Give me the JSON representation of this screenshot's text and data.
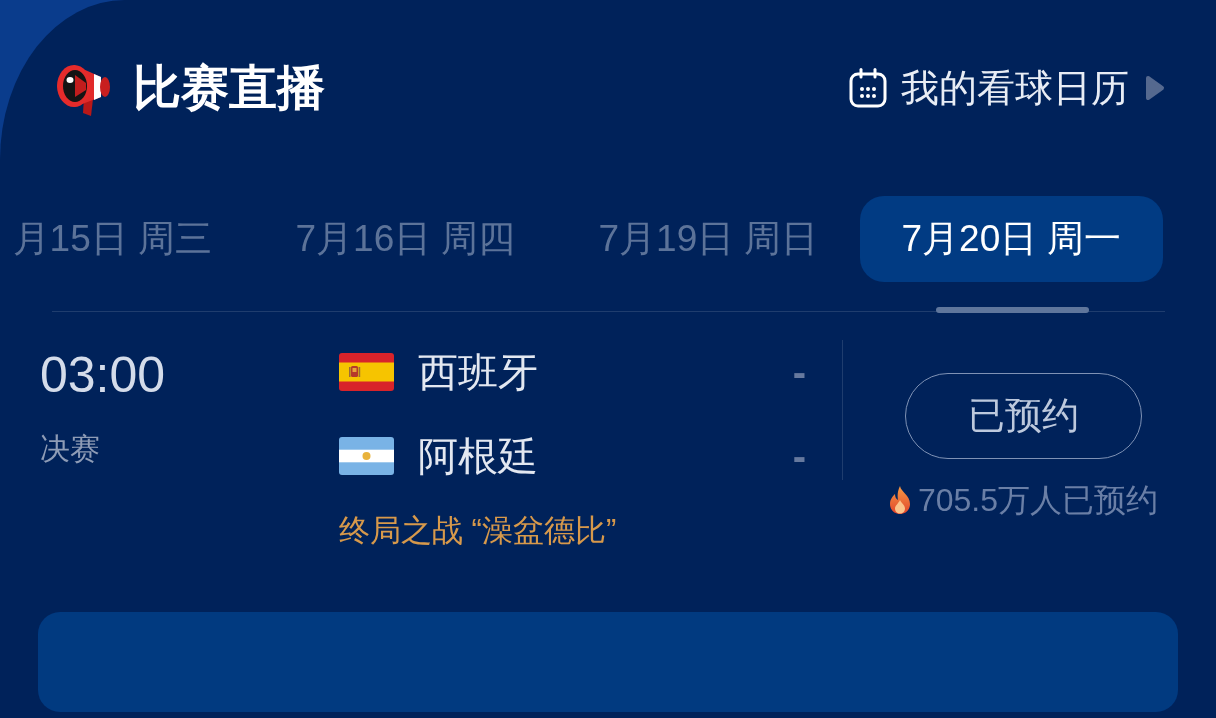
{
  "header": {
    "title": "比赛直播",
    "calendar_link": "我的看球日历"
  },
  "date_tabs": [
    {
      "label": "月15日 周三",
      "selected": false
    },
    {
      "label": "7月16日 周四",
      "selected": false
    },
    {
      "label": "7月19日 周日",
      "selected": false
    },
    {
      "label": "7月20日 周一",
      "selected": true
    }
  ],
  "matches": [
    {
      "time": "03:00",
      "stage": "决赛",
      "teams": [
        {
          "name": "西班牙",
          "kind": "spain",
          "score": "-"
        },
        {
          "name": "阿根廷",
          "kind": "argentina",
          "score": "-"
        }
      ],
      "note": "终局之战 “澡盆德比”",
      "reserve_button": "已预约",
      "reserve_count": "705.5万人已预约"
    }
  ]
}
